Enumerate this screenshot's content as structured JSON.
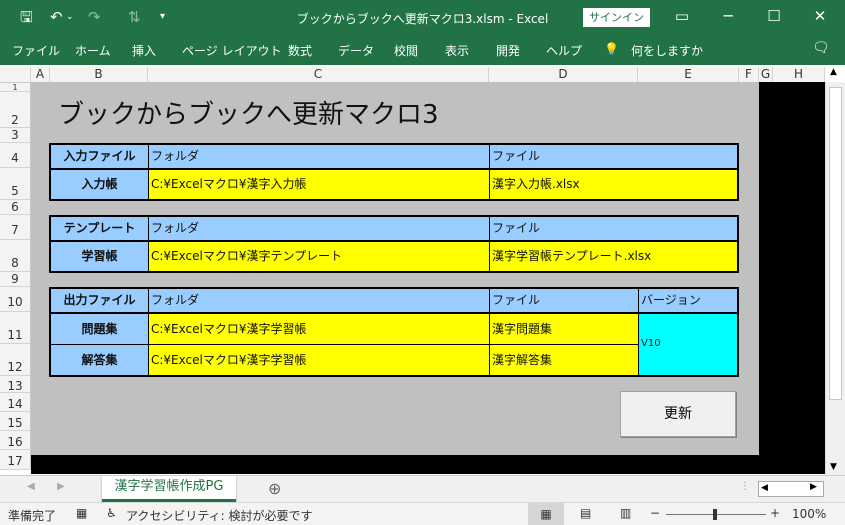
{
  "titlebar": {
    "title": "ブックからブックへ更新マクロ3.xlsm  -  Excel",
    "signin": "サインイン"
  },
  "ribbon": {
    "tabs": [
      "ファイル",
      "ホーム",
      "挿入",
      "ページ レイアウト",
      "数式",
      "データ",
      "校閲",
      "表示",
      "開発",
      "ヘルプ",
      "何をしますか"
    ]
  },
  "columns": [
    "A",
    "B",
    "C",
    "D",
    "E",
    "F",
    "G",
    "H"
  ],
  "rows": [
    "1",
    "2",
    "3",
    "4",
    "5",
    "6",
    "7",
    "8",
    "9",
    "10",
    "11",
    "12",
    "13",
    "14",
    "15",
    "16",
    "17"
  ],
  "sheet": {
    "title": "ブックからブックへ更新マクロ3",
    "input": {
      "label": "入力ファイル",
      "folder_hdr": "フォルダ",
      "file_hdr": "ファイル",
      "row_label": "入力帳",
      "folder": "C:¥Excelマクロ¥漢字入力帳",
      "file": "漢字入力帳.xlsx"
    },
    "template": {
      "label": "テンプレート",
      "folder_hdr": "フォルダ",
      "file_hdr": "ファイル",
      "row_label": "学習帳",
      "folder": "C:¥Excelマクロ¥漢字テンプレート",
      "file": "漢字学習帳テンプレート.xlsx"
    },
    "output": {
      "label": "出力ファイル",
      "folder_hdr": "フォルダ",
      "file_hdr": "ファイル",
      "version_hdr": "バージョン",
      "version": "V10",
      "rows": [
        {
          "label": "問題集",
          "folder": "C:¥Excelマクロ¥漢字学習帳",
          "file": "漢字問題集"
        },
        {
          "label": "解答集",
          "folder": "C:¥Excelマクロ¥漢字学習帳",
          "file": "漢字解答集"
        }
      ]
    },
    "update_button": "更新"
  },
  "sheettabs": {
    "active": "漢字学習帳作成PG"
  },
  "status": {
    "ready": "準備完了",
    "accessibility": "アクセシビリティ: 検討が必要です",
    "zoom": "100%"
  }
}
